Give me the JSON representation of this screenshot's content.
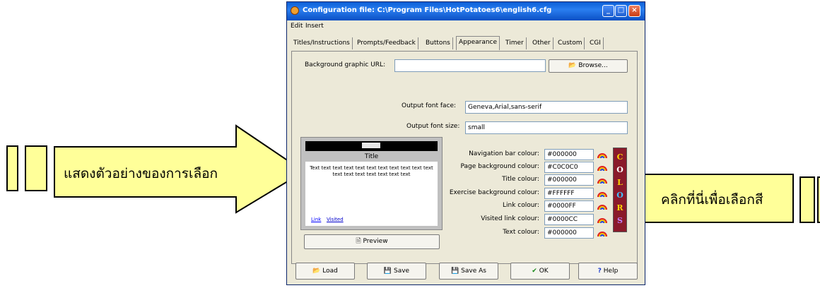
{
  "window": {
    "title": "Configuration file: C:\\Program Files\\HotPotatoes6\\english6.cfg",
    "controls": {
      "minimize": "_",
      "maximize": "□",
      "close": "×"
    }
  },
  "menu": {
    "items": [
      "Edit",
      "Insert"
    ]
  },
  "tabs": [
    "Titles/Instructions",
    "Prompts/Feedback",
    "Buttons",
    "Appearance",
    "Timer",
    "Other",
    "Custom",
    "CGI"
  ],
  "active_tab": "Appearance",
  "appearance": {
    "background_url_label": "Background graphic URL:",
    "background_url_value": "",
    "browse_label": "Browse...",
    "font_face_label": "Output font face:",
    "font_face_value": "Geneva,Arial,sans-serif",
    "font_size_label": "Output font size:",
    "font_size_value": "small"
  },
  "preview": {
    "title": "Title",
    "text": "Text text text text text text text text text text text text text text text text text text",
    "link": "Link",
    "visited": "Visited",
    "button_label": "Preview"
  },
  "colours": [
    {
      "label": "Navigation bar colour:",
      "value": "#000000"
    },
    {
      "label": "Page background colour:",
      "value": "#C0C0C0"
    },
    {
      "label": "Title colour:",
      "value": "#000000"
    },
    {
      "label": "Exercise background colour:",
      "value": "#FFFFFF"
    },
    {
      "label": "Link colour:",
      "value": "#0000FF"
    },
    {
      "label": "Visited link colour:",
      "value": "#0000CC"
    },
    {
      "label": "Text colour:",
      "value": "#000000"
    }
  ],
  "colors_banner": [
    "C",
    "O",
    "L",
    "O",
    "R",
    "S"
  ],
  "buttons": {
    "load": "Load",
    "save": "Save",
    "save_as": "Save As",
    "ok": "OK",
    "help": "Help"
  },
  "annotations": {
    "left": "แสดงตัวอย่างของการเลือก",
    "right": "คลิกที่นี่เพื่อเลือกสี"
  },
  "theme": {
    "titlebar": "#0a5fd6",
    "dialog_bg": "#ece9d8",
    "callout_fill": "#ffff99"
  }
}
